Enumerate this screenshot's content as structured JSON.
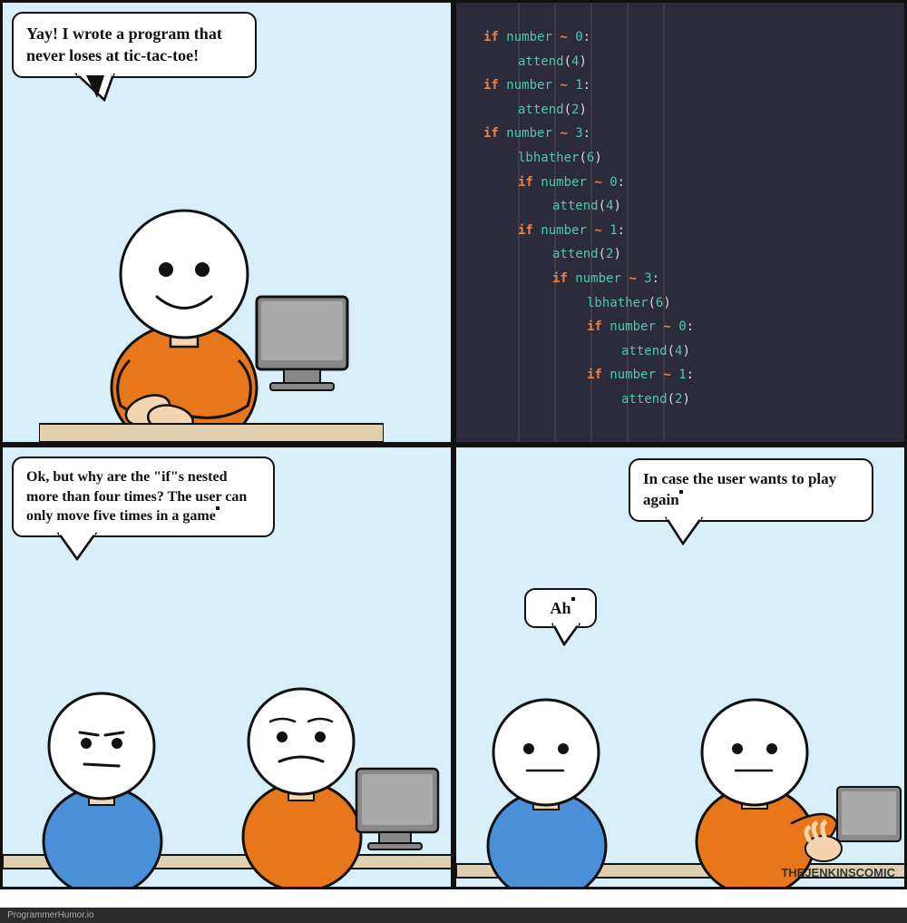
{
  "panels": {
    "panel1": {
      "bubble_text": "Yay! I wrote a program that never loses at tic-tac-toe!",
      "background": "#d8eef8"
    },
    "panel2": {
      "code_lines": [
        {
          "indent": 0,
          "keyword": "if",
          "var": "number",
          "sym": "~",
          "num": "0",
          "extra": ":"
        },
        {
          "indent": 1,
          "keyword": "attend(",
          "var": "4",
          "sym": ")",
          "num": "",
          "extra": ""
        },
        {
          "indent": 0,
          "keyword": "if",
          "var": "number",
          "sym": "~",
          "num": "1",
          "extra": ":"
        },
        {
          "indent": 1,
          "keyword": "attend(",
          "var": "2",
          "sym": ")",
          "num": "",
          "extra": ""
        },
        {
          "indent": 0,
          "keyword": "if",
          "var": "number",
          "sym": "~",
          "num": "3",
          "extra": ":"
        },
        {
          "indent": 1,
          "keyword": "lbhather(",
          "var": "6",
          "sym": ")",
          "num": "",
          "extra": ""
        },
        {
          "indent": 1,
          "keyword": "if",
          "var": "number",
          "sym": "~",
          "num": "0",
          "extra": ":"
        },
        {
          "indent": 2,
          "keyword": "attend(",
          "var": "4",
          "sym": ")",
          "num": "",
          "extra": ""
        },
        {
          "indent": 1,
          "keyword": "if",
          "var": "number",
          "sym": "~",
          "num": "1",
          "extra": ":"
        },
        {
          "indent": 2,
          "keyword": "attend(",
          "var": "2",
          "sym": ")",
          "num": "",
          "extra": ""
        },
        {
          "indent": 2,
          "keyword": "if",
          "var": "number",
          "sym": "~",
          "num": "3",
          "extra": ":"
        },
        {
          "indent": 3,
          "keyword": "lbhather(",
          "var": "6",
          "sym": ")",
          "num": "",
          "extra": ""
        },
        {
          "indent": 3,
          "keyword": "if",
          "var": "number",
          "sym": "~",
          "num": "0",
          "extra": ":"
        },
        {
          "indent": 4,
          "keyword": "attend(",
          "var": "4",
          "sym": ")",
          "num": "",
          "extra": ""
        },
        {
          "indent": 3,
          "keyword": "if",
          "var": "number",
          "sym": "~",
          "num": "1",
          "extra": ":"
        },
        {
          "indent": 4,
          "keyword": "attend(",
          "var": "2",
          "sym": ")",
          "num": "",
          "extra": ""
        }
      ]
    },
    "panel3": {
      "bubble_text": "Ok, but why are the \"if\"s nested more than four times? The user can only move five times in a game",
      "background": "#d8eef8"
    },
    "panel4": {
      "bubble_text_main": "In case the user wants to play again",
      "bubble_text_response": "Ah",
      "background": "#d8eef8"
    }
  },
  "footer": {
    "left_text": "ProgrammerHumor.io",
    "right_text": "THEJENKINSCOMIC"
  }
}
